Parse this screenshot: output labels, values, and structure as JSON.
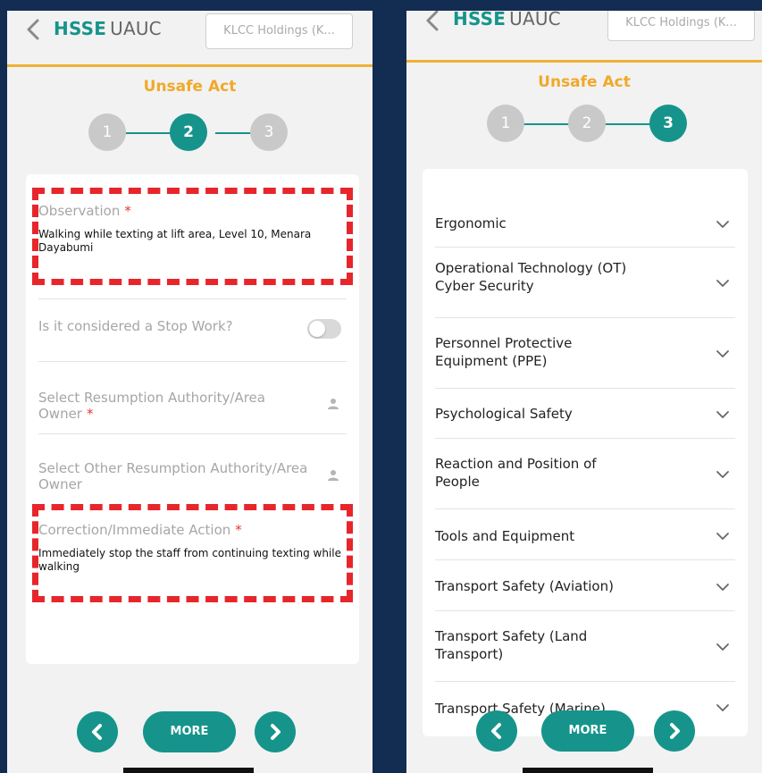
{
  "header": {
    "brand": "HSSE",
    "app": "UAUC",
    "company": "KLCC Holdings (K..."
  },
  "left": {
    "section_title": "Unsafe Act",
    "steps": [
      "1",
      "2",
      "3"
    ],
    "active_step": 2,
    "observation": {
      "label": "Observation",
      "required_mark": "*",
      "value": "Walking while texting at lift area, Level 10, Menara Dayabumi"
    },
    "stop_work": {
      "label": "Is it considered a Stop Work?",
      "checked": false
    },
    "resumption_authority": {
      "label": "Select Resumption Authority/Area Owner",
      "required_mark": "*"
    },
    "other_resumption_authority": {
      "label": "Select Other Resumption Authority/Area Owner"
    },
    "correction": {
      "label": "Correction/Immediate Action",
      "required_mark": "*",
      "value": "Immediately stop the staff from continuing texting while walking"
    },
    "nav": {
      "more_label": "MORE"
    }
  },
  "right": {
    "section_title": "Unsafe Act",
    "steps": [
      "1",
      "2",
      "3"
    ],
    "active_step": 3,
    "categories": [
      {
        "label": "Ergonomic"
      },
      {
        "label": "Operational Technology (OT) Cyber Security"
      },
      {
        "label": "Personnel Protective Equipment (PPE)"
      },
      {
        "label": "Psychological Safety"
      },
      {
        "label": "Reaction and Position of People"
      },
      {
        "label": "Tools and Equipment"
      },
      {
        "label": "Transport Safety (Aviation)"
      },
      {
        "label": "Transport Safety (Land Transport)"
      },
      {
        "label": "Transport Safety (Marine)"
      }
    ],
    "nav": {
      "more_label": "MORE"
    }
  },
  "colors": {
    "brand_teal": "#16948b",
    "accent_orange": "#f0a92b",
    "highlight_red": "#e6262b",
    "background_navy": "#132c52"
  },
  "icons": {
    "back": "chevron-left-icon",
    "expand": "chevron-down-icon",
    "user": "person-icon",
    "prev": "arrow-left-icon",
    "next": "arrow-right-icon"
  }
}
